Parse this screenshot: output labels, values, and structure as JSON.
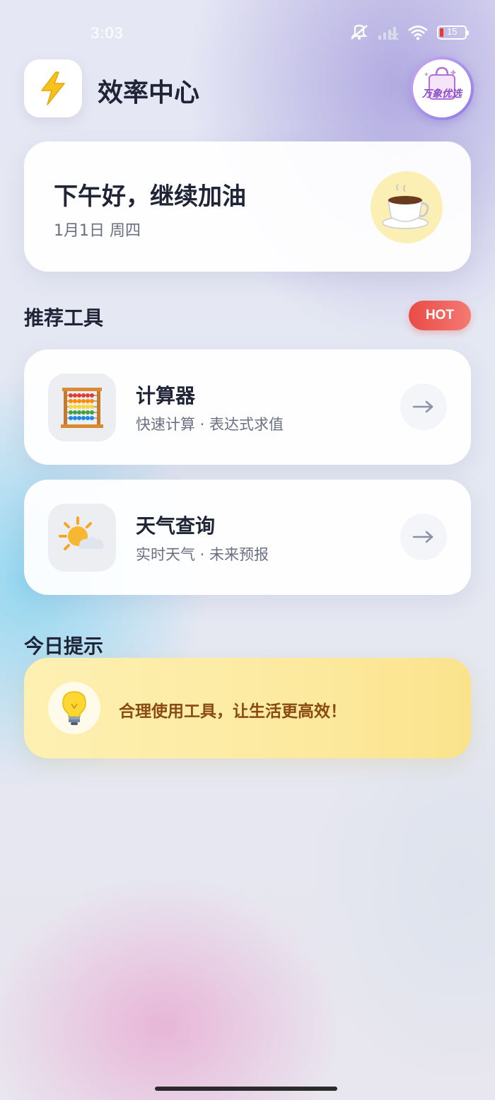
{
  "status_bar": {
    "time": "3:03",
    "battery_level": "15",
    "icons": [
      "mute-icon",
      "signal-icon",
      "wifi-icon",
      "battery-icon"
    ]
  },
  "header": {
    "app_icon": "lightning-icon",
    "title": "效率中心",
    "brand_text": "万象优选"
  },
  "greeting": {
    "title": "下午好，继续加油",
    "date": "1月1日 周四",
    "icon": "coffee-icon"
  },
  "recommend": {
    "title": "推荐工具",
    "badge": "HOT",
    "tools": [
      {
        "name": "计算器",
        "desc": "快速计算 · 表达式求值",
        "icon": "abacus-icon"
      },
      {
        "name": "天气查询",
        "desc": "实时天气 · 未来预报",
        "icon": "sun-cloud-icon"
      }
    ]
  },
  "tips": {
    "title": "今日提示",
    "text": "合理使用工具，让生活更高效！",
    "icon": "lightbulb-icon"
  },
  "colors": {
    "accent_red": "#e94b47",
    "tip_text": "#8a4a12",
    "title_text": "#1f2437"
  }
}
